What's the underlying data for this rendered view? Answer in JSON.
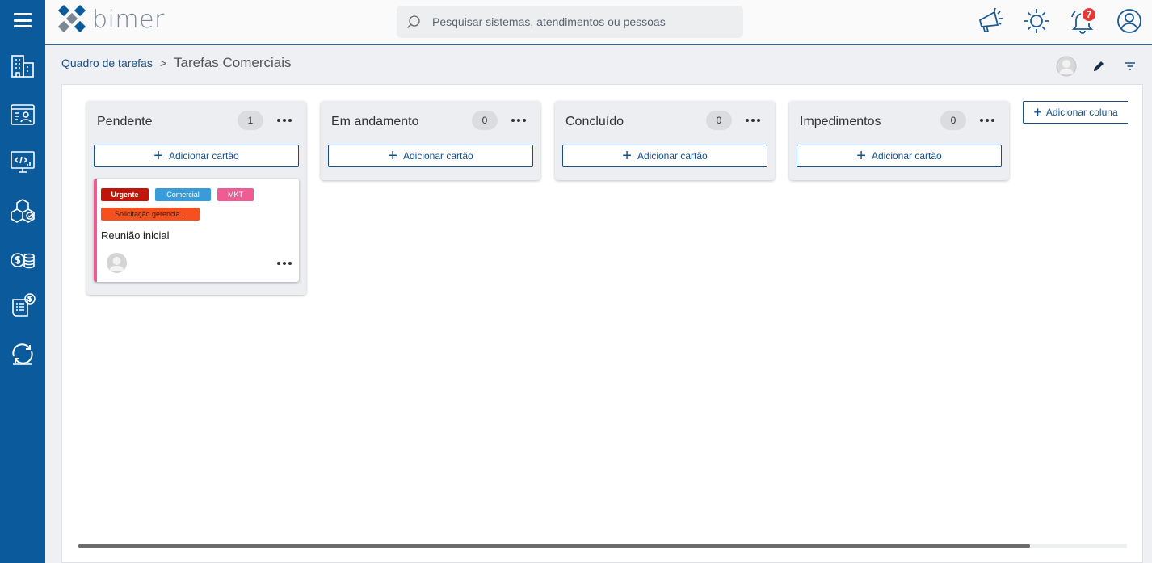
{
  "brand": {
    "name": "bimer",
    "sidebar_color": "#0a5a9c"
  },
  "search": {
    "placeholder": "Pesquisar sistemas, atendimentos ou pessoas"
  },
  "topbar": {
    "icons": [
      "megaphone-icon",
      "sun-icon",
      "bell-icon",
      "user-circle-icon"
    ],
    "notification_count": "7"
  },
  "sidebar": {
    "items": [
      "buildings-icon",
      "id-card-icon",
      "monitor-code-icon",
      "cubes-icon",
      "coins-icon",
      "invoice-icon",
      "sync-icon"
    ]
  },
  "breadcrumb": {
    "parent": "Quadro de tarefas",
    "separator": ">",
    "current": "Tarefas Comerciais"
  },
  "board": {
    "add_card_label": "Adicionar cartão",
    "add_column_label": "Adicionar coluna",
    "columns": [
      {
        "title": "Pendente",
        "count": "1",
        "cards": [
          {
            "title": "Reunião inicial",
            "accent_color": "#ef5b93",
            "tags": [
              {
                "label": "Urgente",
                "color": "#c0150a"
              },
              {
                "label": "Comercial",
                "color": "#3a9bd9"
              },
              {
                "label": "MKT",
                "color": "#ef5b93"
              },
              {
                "label": "Solicitação gerencia...",
                "color": "#f4511e"
              }
            ]
          }
        ]
      },
      {
        "title": "Em andamento",
        "count": "0",
        "cards": []
      },
      {
        "title": "Concluído",
        "count": "0",
        "cards": []
      },
      {
        "title": "Impedimentos",
        "count": "0",
        "cards": []
      }
    ]
  }
}
